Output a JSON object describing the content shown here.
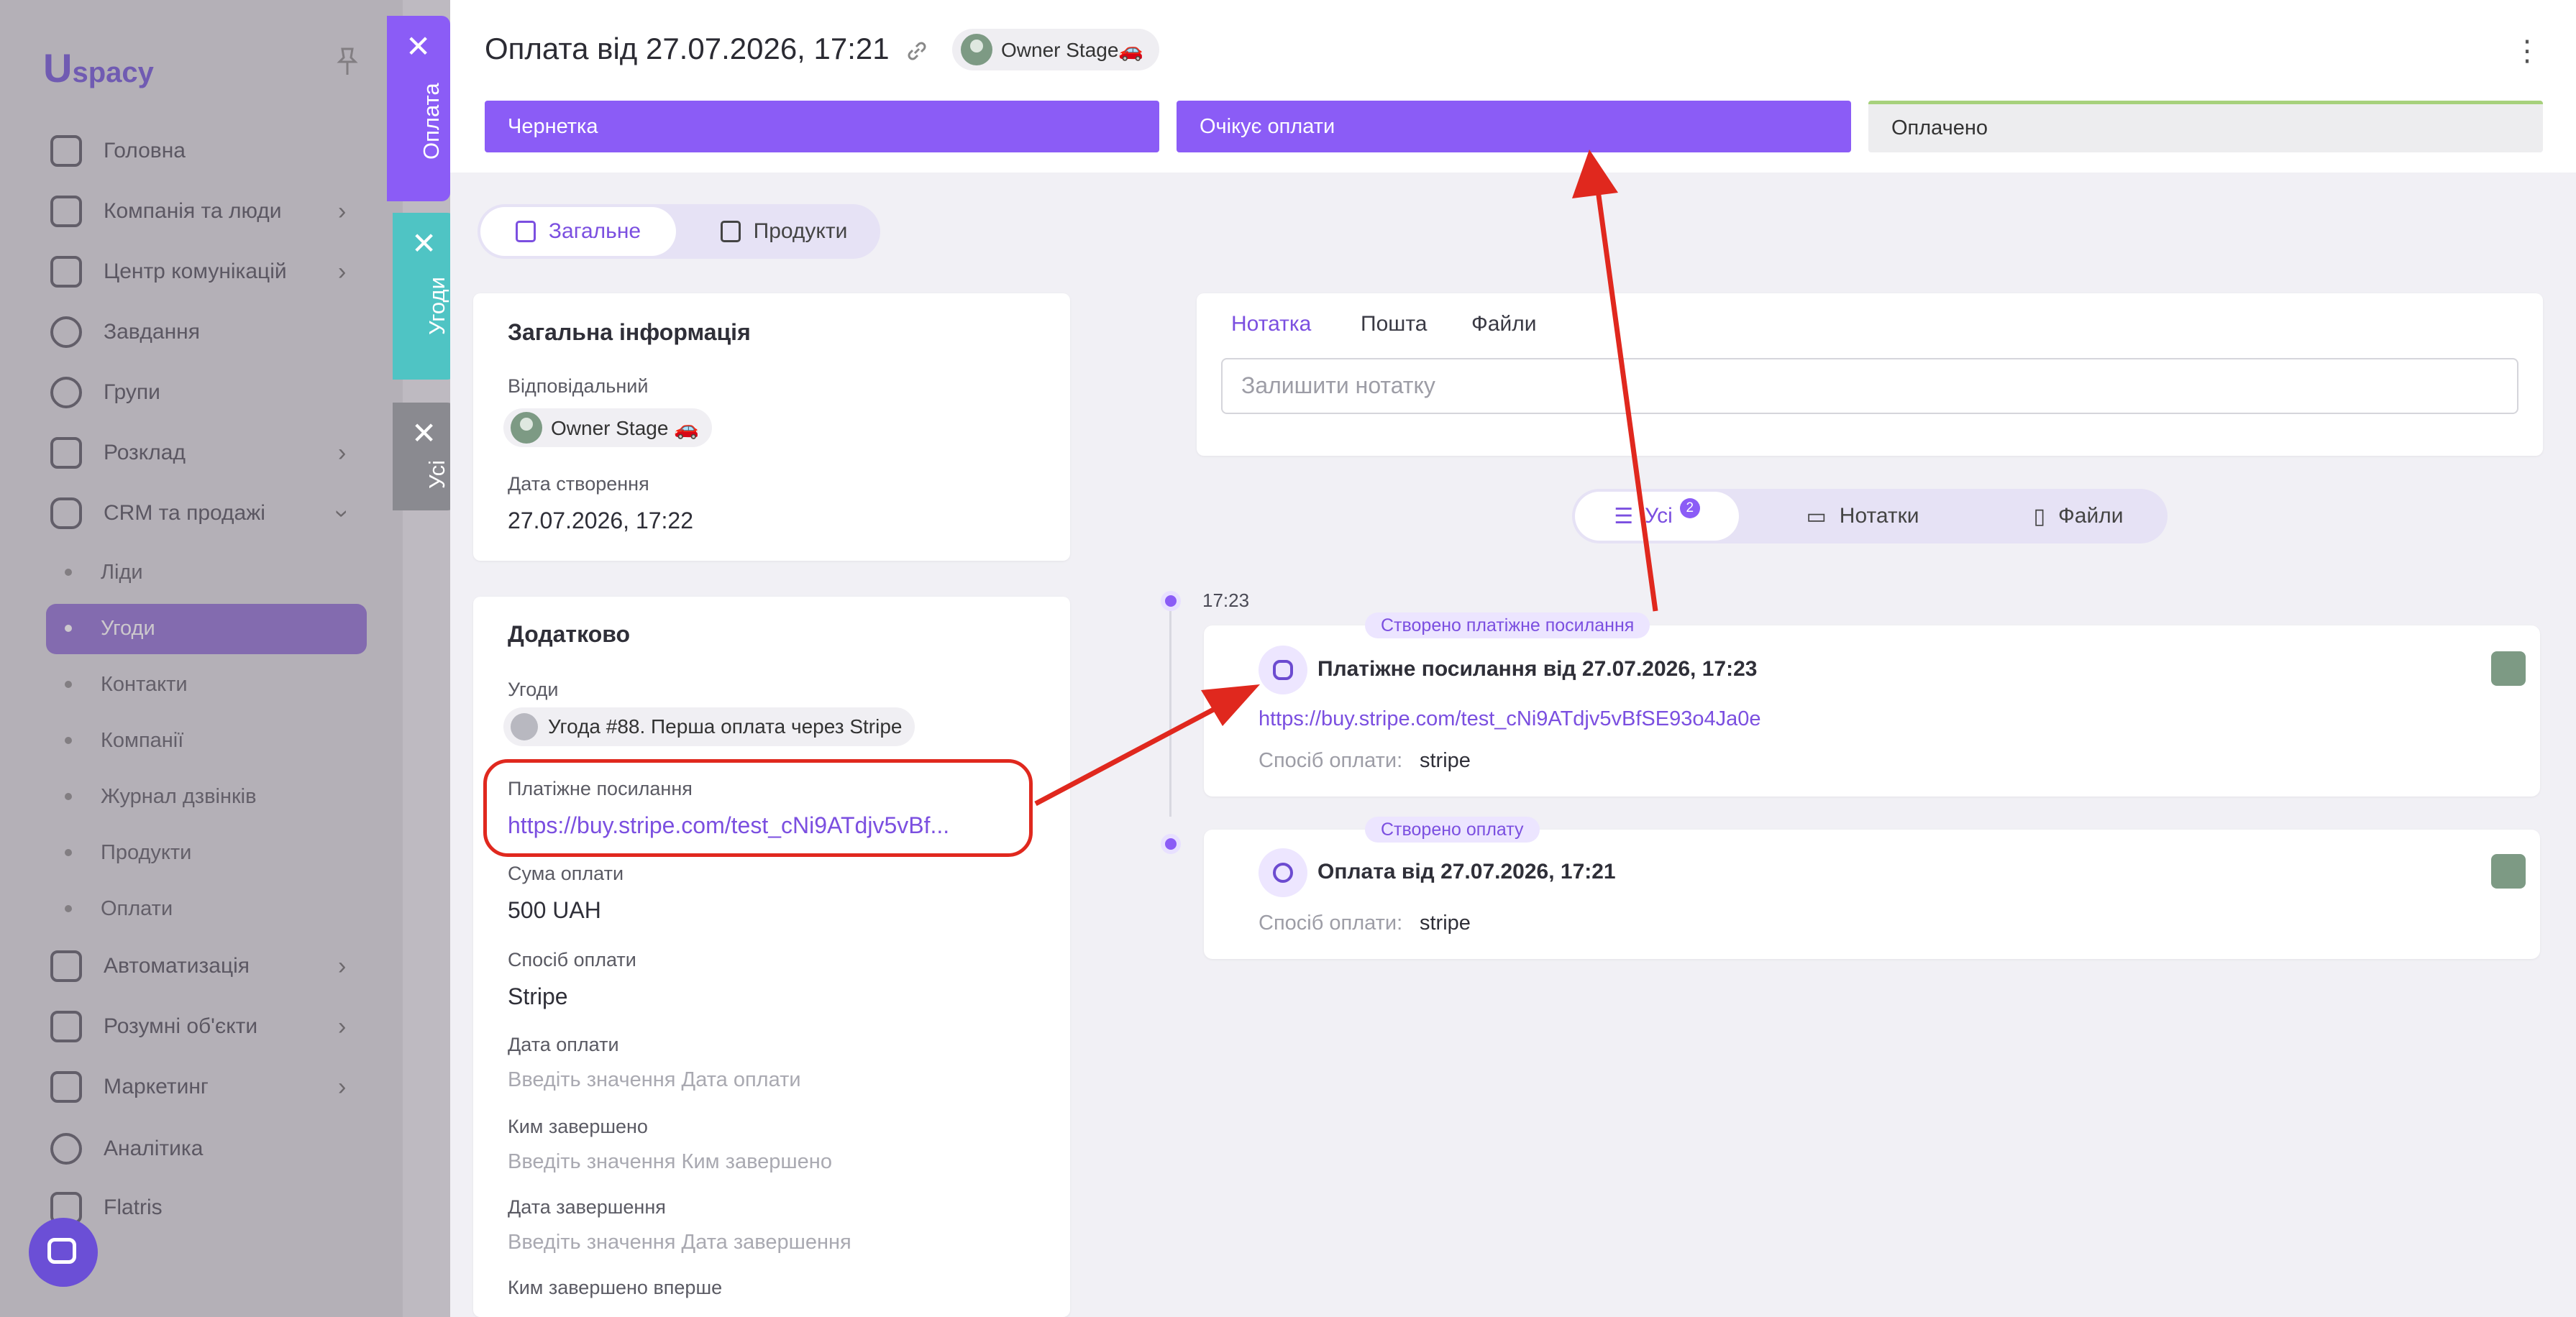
{
  "sidebar": {
    "logo": "spacy",
    "logo_letter": "U",
    "nav": [
      {
        "label": "Головна",
        "icon": "home-icon"
      },
      {
        "label": "Компанія та люди",
        "icon": "company-icon"
      },
      {
        "label": "Центр комунікацій",
        "icon": "chat-icon"
      },
      {
        "label": "Завдання",
        "icon": "check-circle-icon"
      },
      {
        "label": "Групи",
        "icon": "group-icon"
      },
      {
        "label": "Розклад",
        "icon": "calendar-icon"
      },
      {
        "label": "CRM та продажі",
        "icon": "database-icon"
      }
    ],
    "crm_sub": [
      "Ліди",
      "Угоди",
      "Контакти",
      "Компанії",
      "Журнал дзвінків",
      "Продукти",
      "Оплати"
    ],
    "nav_bottom": [
      {
        "label": "Автоматизація",
        "icon": "lightning-icon"
      },
      {
        "label": "Розумні об'єкти",
        "icon": "smart-object-icon"
      },
      {
        "label": "Маркетинг",
        "icon": "marketing-icon"
      },
      {
        "label": "Аналітика",
        "icon": "analytics-icon"
      },
      {
        "label": "Flatris",
        "icon": "flatris-icon"
      }
    ]
  },
  "vtabs": {
    "payment": "Оплата",
    "deals": "Угоди",
    "all": "Усі"
  },
  "header": {
    "title": "Оплата від 27.07.2026, 17:21",
    "owner": "Owner Stage🚗",
    "stages": [
      "Чернетка",
      "Очікує оплати",
      "Оплачено"
    ]
  },
  "tabs": {
    "general": "Загальне",
    "products": "Продукти"
  },
  "general_info": {
    "title": "Загальна інформація",
    "responsible_label": "Відповідальний",
    "responsible_value": "Owner Stage 🚗",
    "created_label": "Дата створення",
    "created_value": "27.07.2026, 17:22"
  },
  "additional": {
    "title": "Додатково",
    "deals_label": "Угоди",
    "deal_value": "Угода #88. Перша оплата через Stripe",
    "pay_link_label": "Платіжне посилання",
    "pay_link_value": "https://buy.stripe.com/test_cNi9ATdjv5vBf...",
    "amount_label": "Сума оплати",
    "amount_value": "500 UAH",
    "method_label": "Спосіб оплати",
    "method_value": "Stripe",
    "pay_date_label": "Дата оплати",
    "pay_date_ph": "Введіть значення Дата оплати",
    "completed_by_label": "Ким завершено",
    "completed_by_ph": "Введіть значення Ким завершено",
    "completed_date_label": "Дата завершення",
    "completed_date_ph": "Введіть значення Дата завершення",
    "first_completed_label": "Ким завершено вперше"
  },
  "notes": {
    "tabs": [
      "Нотатка",
      "Пошта",
      "Файли"
    ],
    "placeholder": "Залишити нотатку"
  },
  "filters": {
    "all": "Усі",
    "all_count": "2",
    "notes": "Нотатки",
    "files": "Файли"
  },
  "timeline": {
    "time": "17:23",
    "events": [
      {
        "tag": "Створено платіжне посилання",
        "title": "Платіжне посилання від 27.07.2026, 17:23",
        "link": "https://buy.stripe.com/test_cNi9ATdjv5vBfSE93o4Ja0e",
        "meta_label": "Спосіб оплати:",
        "meta_value": "stripe"
      },
      {
        "tag": "Створено оплату",
        "title": "Оплата від 27.07.2026, 17:21",
        "meta_label": "Спосіб оплати:",
        "meta_value": "stripe"
      }
    ]
  },
  "colors": {
    "accent": "#8b5cf6",
    "paid_bar": "#a7d17c",
    "annotation": "#e0281e",
    "vtab_payment": "#8b5cf6",
    "vtab_deals": "#4fc4c4",
    "vtab_all": "#8a8a90"
  }
}
